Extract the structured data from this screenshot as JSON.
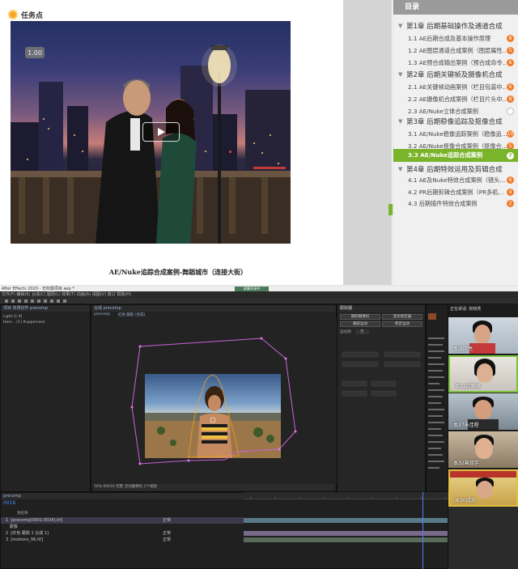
{
  "task": {
    "label": "任务点"
  },
  "video": {
    "speed": "1.00",
    "caption": "AE/Nuke追踪合成案例-舞蹈城市（连接大街）"
  },
  "toc": {
    "title": "目录",
    "chapters": [
      {
        "label": "第1章 后期基础操作及通道合成"
      },
      {
        "label": "第2章 后期关键帧及摄像机合成"
      },
      {
        "label": "第3章 后期稳像追踪及抠像合成"
      },
      {
        "label": "第4章 后期特效运用及剪辑合成"
      }
    ],
    "items": [
      {
        "label": "1.1 AE后期合成及基本操作原理",
        "badge": "8"
      },
      {
        "label": "1.2 AE图层通道合成案例（图层属性…",
        "badge": "5"
      },
      {
        "label": "1.3 AE预合成输出案例（预合成命令…",
        "badge": "6"
      },
      {
        "label": "2.1 AE关键帧动画案例（栏目包装中…",
        "badge": "6"
      },
      {
        "label": "2.2 AE摄像机合成案例（栏目片头中…",
        "badge": "8"
      },
      {
        "label": "2.3 AE/Nuke立体合成案例",
        "badge": ""
      },
      {
        "label": "3.1 AE/Nuke稳像追踪案例（稳像追…",
        "badge": "10"
      },
      {
        "label": "3.2 AE/Nuke抠像合成案例（抠像合…",
        "badge": "5"
      },
      {
        "label": "3.3 AE/Nuke追踪合成案例",
        "badge": "7"
      },
      {
        "label": "4.1 AE及Nuke特效合成案例（镜头…",
        "badge": "6"
      },
      {
        "label": "4.2 PR后期剪辑合成案例（PR多机…",
        "badge": "4"
      },
      {
        "label": "4.3 后期插件特效合成案例",
        "badge": "2"
      }
    ]
  },
  "ae": {
    "title": "After Effects 2020 - 无标题项目.aep *",
    "share": "屏幕共享中",
    "menu": "文件(F)  编辑(E)  合成(C)  图层(L)  效果(T)  动画(A)  视图(V)  窗口  帮助(H)",
    "project_tab": "项目  效果控件 precomp",
    "project_lines": [
      "Light [1.9]",
      "Hero ...[1] #uppercase"
    ],
    "comp_tab": "合成 precomp",
    "comp_label": "precomp",
    "comp_sub": "红色 跟踪 (合成)",
    "comp_footer": "50%   00016   完整   活动摄像机   1个视图",
    "effect_tab": "跟踪器",
    "effect_buttons": [
      "跟踪摄像机",
      "变形稳定器",
      "跟踪运动",
      "稳定运动"
    ],
    "effect_label1": "运动源:",
    "effect_value1": "无",
    "timeline_tab": "precomp",
    "timecode": "0016",
    "tl_header": "源名称",
    "layers": [
      {
        "num": "1",
        "name": "[precomp[0001-0034].tif]",
        "mode": "正常"
      },
      {
        "num": "",
        "name": "蒙版",
        "mode": ""
      },
      {
        "num": "2",
        "name": "[红色 跟踪 1 合成 1]",
        "mode": "正常"
      },
      {
        "num": "3",
        "name": "[motions_06.tif]",
        "mode": "正常"
      }
    ],
    "meet_title": "正在讲话: 张晓亮",
    "participants": [
      {
        "name": "本张晓亮"
      },
      {
        "name": "本22吕紫涵"
      },
      {
        "name": "本37朱佳程"
      },
      {
        "name": "本32曾效宇"
      },
      {
        "name": "本30成龙"
      }
    ],
    "accent": "#9e4ecf"
  }
}
